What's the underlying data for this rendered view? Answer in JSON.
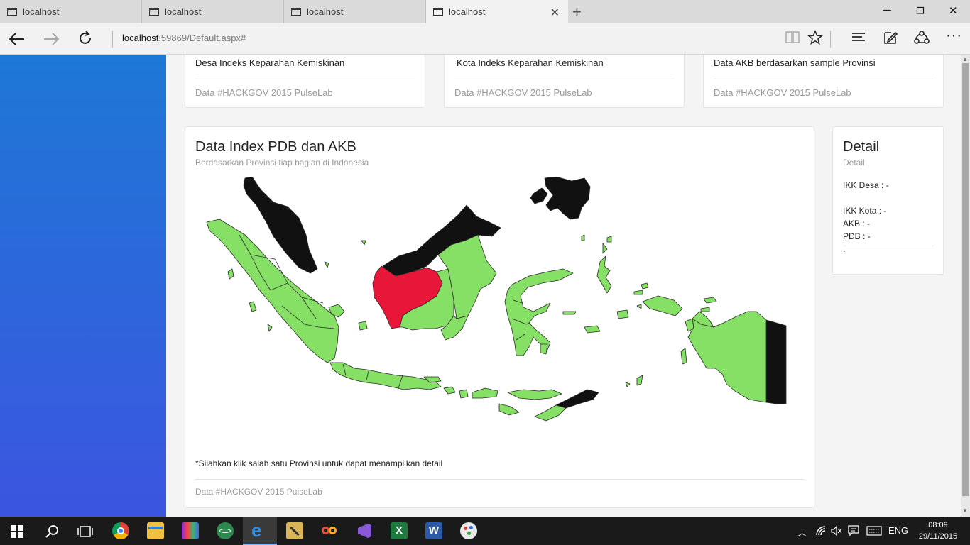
{
  "browser": {
    "tabs": [
      {
        "label": "localhost"
      },
      {
        "label": "localhost"
      },
      {
        "label": "localhost"
      },
      {
        "label": "localhost"
      }
    ],
    "address": {
      "host": "localhost",
      "rest": ":59869/Default.aspx#"
    },
    "nav_icons": [
      "back-arrow-icon",
      "forward-arrow-icon",
      "refresh-icon"
    ],
    "toolbar_icons": [
      "reading-view-icon",
      "favorite-star-icon",
      "hub-icon",
      "web-note-icon",
      "share-icon",
      "more-icon"
    ]
  },
  "top_cards": [
    {
      "title": "Desa Indeks Keparahan Kemiskinan",
      "footer": "Data #HACKGOV 2015 PulseLab"
    },
    {
      "title": "Kota Indeks Keparahan Kemiskinan",
      "footer": "Data #HACKGOV 2015 PulseLab"
    },
    {
      "title": "Data AKB berdasarkan sample Provinsi",
      "footer": "Data #HACKGOV 2015 PulseLab"
    }
  ],
  "map_card": {
    "title": "Data Index PDB dan AKB",
    "subtitle": "Berdasarkan Provinsi tiap bagian di Indonesia",
    "hint": "*Silahkan klik salah satu Provinsi untuk dapat menampilkan detail",
    "footer": "Data #HACKGOV 2015 PulseLab",
    "colors": {
      "province": "#86e065",
      "selected": "#e8173a",
      "foreign": "#111111"
    }
  },
  "detail": {
    "title": "Detail",
    "subtitle": "Detail",
    "ikk_desa": "IKK Desa : -",
    "ikk_kota": "IKK Kota : -",
    "akb": "AKB : -",
    "pdb": "PDB : -",
    "tick": "`"
  },
  "taskbar": {
    "lang": "ENG",
    "time": "08:09",
    "date": "29/11/2015",
    "apps": [
      "start-icon",
      "search-icon",
      "task-view-icon",
      "chrome-icon",
      "file-explorer-icon",
      "winrar-icon",
      "atom-icon",
      "edge-icon",
      "tools-icon",
      "infinity-icon",
      "visual-studio-icon",
      "excel-icon",
      "word-icon",
      "paint-icon"
    ]
  }
}
